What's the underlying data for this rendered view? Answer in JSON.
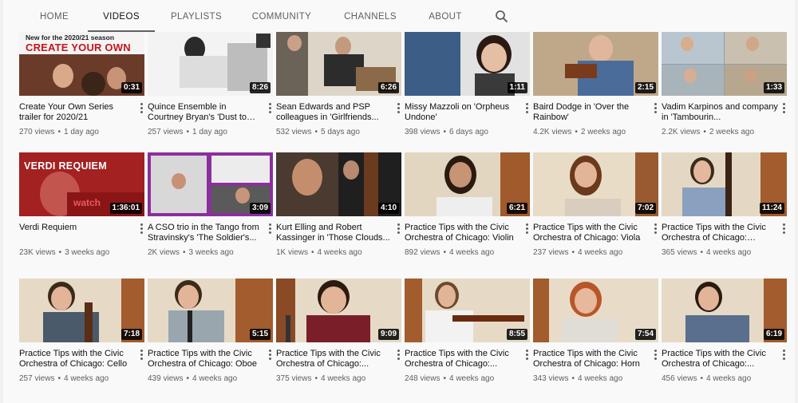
{
  "tabs": [
    {
      "label": "HOME"
    },
    {
      "label": "VIDEOS"
    },
    {
      "label": "PLAYLISTS"
    },
    {
      "label": "COMMUNITY"
    },
    {
      "label": "CHANNELS"
    },
    {
      "label": "ABOUT"
    }
  ],
  "active_tab": "VIDEOS",
  "search_icon": "search-icon",
  "videos": [
    {
      "title": "Create Your Own Series trailer for 2020/21",
      "duration": "0:31",
      "views": "270 views",
      "age": "1 day ago",
      "overlay_line1": "New for the 2020/21 season",
      "overlay_line2": "CREATE YOUR OWN"
    },
    {
      "title": "Quince Ensemble in Courtney Bryan's 'Dust to Dust' from...",
      "duration": "8:26",
      "views": "257 views",
      "age": "1 day ago"
    },
    {
      "title": "Sean Edwards and PSP colleagues in 'Girlfriends...",
      "duration": "6:26",
      "views": "532 views",
      "age": "5 days ago"
    },
    {
      "title": "Missy Mazzoli on 'Orpheus Undone'",
      "duration": "1:11",
      "views": "398 views",
      "age": "6 days ago"
    },
    {
      "title": "Baird Dodge in 'Over the Rainbow'",
      "duration": "2:15",
      "views": "4.2K views",
      "age": "2 weeks ago"
    },
    {
      "title": "Vadim Karpinos and company in 'Tambourin...",
      "duration": "1:33",
      "views": "2.2K views",
      "age": "2 weeks ago"
    },
    {
      "title": "Verdi Requiem",
      "duration": "1:36:01",
      "views": "23K views",
      "age": "3 weeks ago",
      "overlay_line1": "VERDI REQUIEM",
      "overlay_line2": "watch"
    },
    {
      "title": "A CSO trio in the Tango from Stravinsky's 'The Soldier's...",
      "duration": "3:09",
      "views": "2K views",
      "age": "3 weeks ago"
    },
    {
      "title": "Kurt Elling and Robert Kassinger in 'Those Clouds...",
      "duration": "4:10",
      "views": "1K views",
      "age": "4 weeks ago"
    },
    {
      "title": "Practice Tips with the Civic Orchestra of Chicago: Violin",
      "duration": "6:21",
      "views": "892 views",
      "age": "4 weeks ago"
    },
    {
      "title": "Practice Tips with the Civic Orchestra of Chicago: Viola",
      "duration": "7:02",
      "views": "237 views",
      "age": "4 weeks ago"
    },
    {
      "title": "Practice Tips with the Civic Orchestra of Chicago: Doubl...",
      "duration": "11:24",
      "views": "365 views",
      "age": "4 weeks ago"
    },
    {
      "title": "Practice Tips with the Civic Orchestra of Chicago: Cello",
      "duration": "7:18",
      "views": "257 views",
      "age": "4 weeks ago"
    },
    {
      "title": "Practice Tips with the Civic Orchestra of Chicago: Oboe",
      "duration": "5:15",
      "views": "439 views",
      "age": "4 weeks ago"
    },
    {
      "title": "Practice Tips with the Civic Orchestra of Chicago:...",
      "duration": "9:09",
      "views": "375 views",
      "age": "4 weeks ago"
    },
    {
      "title": "Practice Tips with the Civic Orchestra of Chicago:...",
      "duration": "8:55",
      "views": "248 views",
      "age": "4 weeks ago"
    },
    {
      "title": "Practice Tips with the Civic Orchestra of Chicago: Horn",
      "duration": "7:54",
      "views": "343 views",
      "age": "4 weeks ago"
    },
    {
      "title": "Practice Tips with the Civic Orchestra of Chicago:...",
      "duration": "6:19",
      "views": "456 views",
      "age": "4 weeks ago"
    }
  ],
  "sep": "•"
}
